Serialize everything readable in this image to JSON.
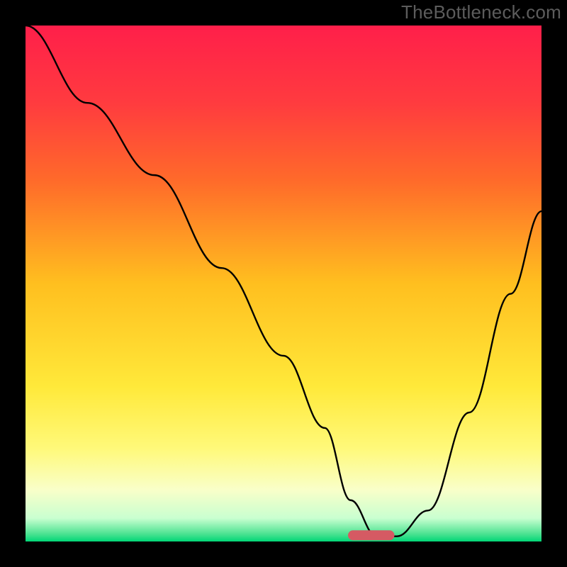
{
  "watermark": "TheBottleneck.com",
  "chart_data": {
    "type": "line",
    "title": "",
    "xlabel": "",
    "ylabel": "",
    "xlim": [
      0,
      100
    ],
    "ylim": [
      0,
      100
    ],
    "grid": false,
    "background_gradient": {
      "type": "vertical",
      "stops": [
        {
          "offset": 0.0,
          "color": "#ff1f4a"
        },
        {
          "offset": 0.15,
          "color": "#ff3b3f"
        },
        {
          "offset": 0.3,
          "color": "#ff6a2a"
        },
        {
          "offset": 0.5,
          "color": "#ffbf1f"
        },
        {
          "offset": 0.7,
          "color": "#ffe93a"
        },
        {
          "offset": 0.82,
          "color": "#fff97a"
        },
        {
          "offset": 0.9,
          "color": "#f9ffc9"
        },
        {
          "offset": 0.955,
          "color": "#c9ffd0"
        },
        {
          "offset": 0.985,
          "color": "#4de392"
        },
        {
          "offset": 1.0,
          "color": "#00d676"
        }
      ]
    },
    "series": [
      {
        "name": "bottleneck-curve",
        "color": "#000000",
        "x": [
          0,
          12,
          25,
          38,
          50,
          58,
          63,
          68,
          72,
          78,
          86,
          94,
          100
        ],
        "y": [
          100,
          85,
          71,
          53,
          36,
          22,
          8,
          1,
          1,
          6,
          25,
          48,
          64
        ]
      }
    ],
    "marker": {
      "name": "optimal-zone",
      "color": "#d55a63",
      "x_center": 67,
      "width_pct": 9,
      "y": 1.2,
      "rx_pct": 1.5
    }
  }
}
